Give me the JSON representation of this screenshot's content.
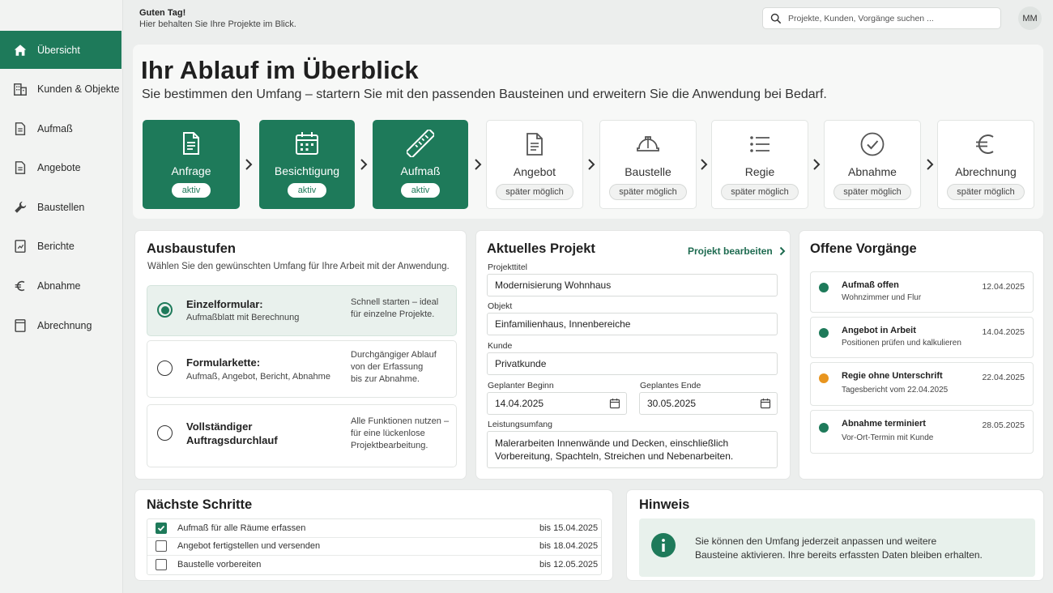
{
  "topbar": {
    "greeting": "Guten Tag!",
    "subtitle": "Hier behalten Sie Ihre Projekte im Blick.",
    "search_placeholder": "Projekte, Kunden, Vorgänge suchen ...",
    "avatar_initials": "MM"
  },
  "sidebar": {
    "items": [
      {
        "label": "Übersicht",
        "icon": "home-icon",
        "active": true
      },
      {
        "label": "Kunden & Objekte",
        "icon": "building-icon",
        "active": false
      },
      {
        "label": "Aufmaß",
        "icon": "document-icon",
        "active": false
      },
      {
        "label": "Angebote",
        "icon": "document-icon",
        "active": false
      },
      {
        "label": "Baustellen",
        "icon": "wrench-icon",
        "active": false
      },
      {
        "label": "Berichte",
        "icon": "report-icon",
        "active": false
      },
      {
        "label": "Abnahme",
        "icon": "euro-icon",
        "active": false
      },
      {
        "label": "Abrechnung",
        "icon": "ledger-icon",
        "active": false
      }
    ]
  },
  "hero": {
    "title": "Ihr Ablauf im Überblick",
    "subtitle": "Sie bestimmen den Umfang – startern Sie mit den passenden Bausteinen und erweitern Sie die Anwendung bei Bedarf.",
    "steps": [
      {
        "label": "Anfrage",
        "status": "aktiv",
        "icon": "document-icon"
      },
      {
        "label": "Besichtigung",
        "status": "aktiv",
        "icon": "calendar-icon"
      },
      {
        "label": "Aufmaß",
        "status": "aktiv",
        "icon": "ruler-icon"
      },
      {
        "label": "Angebot",
        "status": "später möglich",
        "icon": "document-icon"
      },
      {
        "label": "Baustelle",
        "status": "später möglich",
        "icon": "hardhat-icon"
      },
      {
        "label": "Regie",
        "status": "später möglich",
        "icon": "list-icon"
      },
      {
        "label": "Abnahme",
        "status": "später möglich",
        "icon": "check-circle-icon"
      },
      {
        "label": "Abrechnung",
        "status": "später möglich",
        "icon": "euro-icon"
      }
    ]
  },
  "ausbau": {
    "title": "Ausbaustufen",
    "description": "Wählen Sie den gewünschten Umfang für Ihre Arbeit mit der Anwendung.",
    "options": [
      {
        "title": "Einzelformular:",
        "subtitle": "Aufmaßblatt mit Berechnung",
        "desc_1": "Schnell starten – ideal",
        "desc_2": "für einzelne Projekte.",
        "desc_3": "",
        "selected": true
      },
      {
        "title": "Formularkette:",
        "subtitle": "Aufmaß, Angebot, Bericht, Abnahme",
        "desc_1": "Durchgängiger Ablauf",
        "desc_2": "von der Erfassung",
        "desc_3": "bis zur Abnahme.",
        "selected": false
      },
      {
        "title": "Vollständiger Auftragsdurchlauf",
        "subtitle": "",
        "desc_1": "Alle Funktionen nutzen –",
        "desc_2": "für eine lückenlose",
        "desc_3": "Projektbearbeitung.",
        "selected": false
      }
    ]
  },
  "project": {
    "title": "Aktuelles Projekt",
    "edit_label": "Projekt bearbeiten",
    "fields": {
      "titel_label": "Projekttitel",
      "titel_value": "Modernisierung Wohnhaus",
      "objekt_label": "Objekt",
      "objekt_value": "Einfamilienhaus, Innenbereiche",
      "kunde_label": "Kunde",
      "kunde_value": "Privatkunde",
      "beginn_label": "Geplanter Beginn",
      "beginn_value": "14.04.2025",
      "ende_label": "Geplantes Ende",
      "ende_value": "30.05.2025",
      "umfang_label": "Leistungsumfang",
      "umfang_line_1": "Malerarbeiten Innenwände und Decken, einschließlich",
      "umfang_line_2": "Vorbereitung, Spachteln, Streichen und Nebenarbeiten."
    }
  },
  "offen": {
    "title": "Offene Vorgänge",
    "items": [
      {
        "title": "Aufmaß offen",
        "subtitle": "Wohnzimmer und Flur",
        "date": "12.04.2025",
        "color": "#1e7a5a"
      },
      {
        "title": "Angebot in Arbeit",
        "subtitle": "Positionen prüfen und kalkulieren",
        "date": "14.04.2025",
        "color": "#1e7a5a"
      },
      {
        "title": "Regie ohne Unterschrift",
        "subtitle": "Tagesbericht vom 22.04.2025",
        "date": "22.04.2025",
        "color": "#e8951f"
      },
      {
        "title": "Abnahme terminiert",
        "subtitle": "Vor-Ort-Termin mit Kunde",
        "date": "28.05.2025",
        "color": "#1e7a5a"
      }
    ]
  },
  "next": {
    "title": "Nächste Schritte",
    "tasks": [
      {
        "label": "Aufmaß für alle Räume erfassen",
        "due": "bis 15.04.2025",
        "done": true
      },
      {
        "label": "Angebot fertigstellen und versenden",
        "due": "bis 18.04.2025",
        "done": false
      },
      {
        "label": "Baustelle vorbereiten",
        "due": "bis 12.05.2025",
        "done": false
      }
    ]
  },
  "hint": {
    "title": "Hinweis",
    "line_1": "Sie können den Umfang jederzeit anpassen und weitere",
    "line_2": "Bausteine aktivieren. Ihre bereits erfassten Daten bleiben erhalten."
  },
  "colors": {
    "accent": "#1e7a5a",
    "warning": "#e8951f"
  }
}
